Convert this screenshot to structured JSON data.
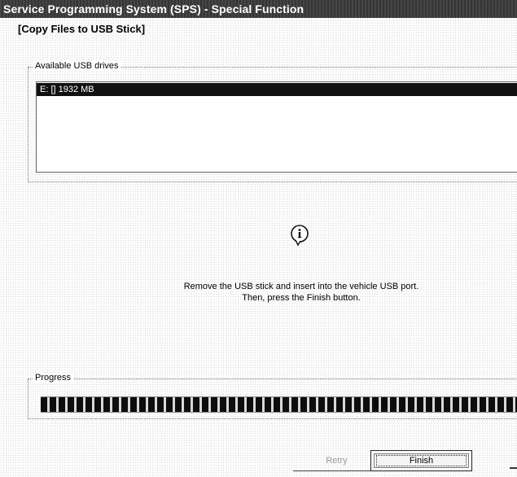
{
  "window": {
    "title": "Service Programming System (SPS) - Special Function"
  },
  "section": {
    "title": "[Copy Files to USB Stick]"
  },
  "usb": {
    "group_label": "Available USB drives",
    "drives": [
      {
        "label": "E: [] 1932 MB",
        "selected": true
      }
    ]
  },
  "info": {
    "icon": "info-icon",
    "line1": "Remove the USB stick and insert into the vehicle USB port.",
    "line2": "Then, press the Finish button."
  },
  "progress": {
    "label": "Progress",
    "percent": 100
  },
  "buttons": {
    "retry": "Retry",
    "finish": "Finish"
  },
  "colors": {
    "titlebar": "#3a3a3a",
    "selection": "#111111",
    "progress_fill": "#0d0d0d"
  }
}
